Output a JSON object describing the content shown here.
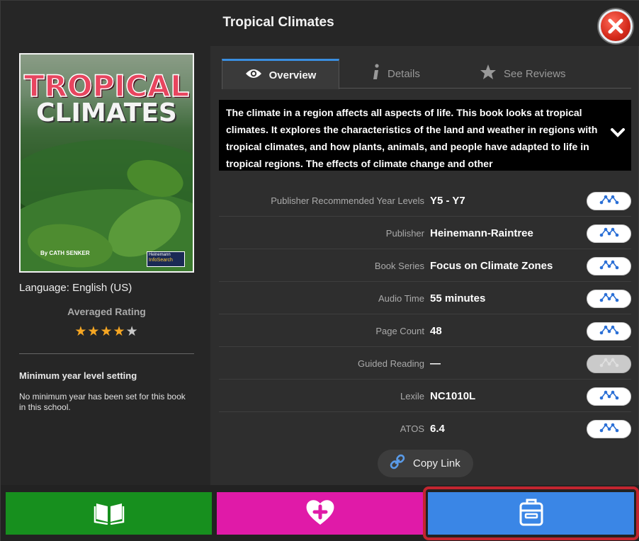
{
  "window": {
    "title": "Tropical Climates"
  },
  "cover": {
    "title_line1": "TROPICAL",
    "title_line2": "CLIMATES",
    "author": "By CATH SENKER",
    "logo_line1": "Heinemann",
    "logo_line2": "InfoSearch"
  },
  "info": {
    "language": "Language: English (US)",
    "rating_label": "Averaged Rating",
    "rating_value": 4,
    "rating_max": 5,
    "min_year_title": "Minimum year level setting",
    "min_year_text": "No minimum year has been set for this book in this school."
  },
  "tabs": [
    {
      "label": "Overview",
      "icon": "eye-icon",
      "active": true
    },
    {
      "label": "Details",
      "icon": "info-icon",
      "active": false
    },
    {
      "label": "See Reviews",
      "icon": "star-icon",
      "active": false
    }
  ],
  "description": "The climate in a region affects all aspects of life. This book looks at tropical climates. It explores the characteristics of the land and weather in regions with tropical climates, and how plants, animals, and people have adapted to life in tropical regions. The effects of climate change and other",
  "details": [
    {
      "label": "Publisher Recommended Year Levels",
      "value": "Y5 - Y7",
      "enabled": true
    },
    {
      "label": "Publisher",
      "value": "Heinemann-Raintree",
      "enabled": true
    },
    {
      "label": "Book Series",
      "value": "Focus on Climate Zones",
      "enabled": true
    },
    {
      "label": "Audio Time",
      "value": "55 minutes",
      "enabled": true
    },
    {
      "label": "Page Count",
      "value": "48",
      "enabled": true
    },
    {
      "label": "Guided Reading",
      "value": "—",
      "enabled": false
    },
    {
      "label": "Lexile",
      "value": "NC1010L",
      "enabled": true
    },
    {
      "label": "ATOS",
      "value": "6.4",
      "enabled": true
    }
  ],
  "copy_link": {
    "label": "Copy Link",
    "icon": "link-icon"
  },
  "footer": {
    "read_icon": "open-book-icon",
    "favourite_icon": "heart-plus-icon",
    "bag_icon": "clipboard-bag-icon",
    "colors": {
      "read": "#178f1e",
      "favourite": "#e01aa8",
      "bag": "#3a86e6",
      "highlight": "#c3252f"
    }
  }
}
